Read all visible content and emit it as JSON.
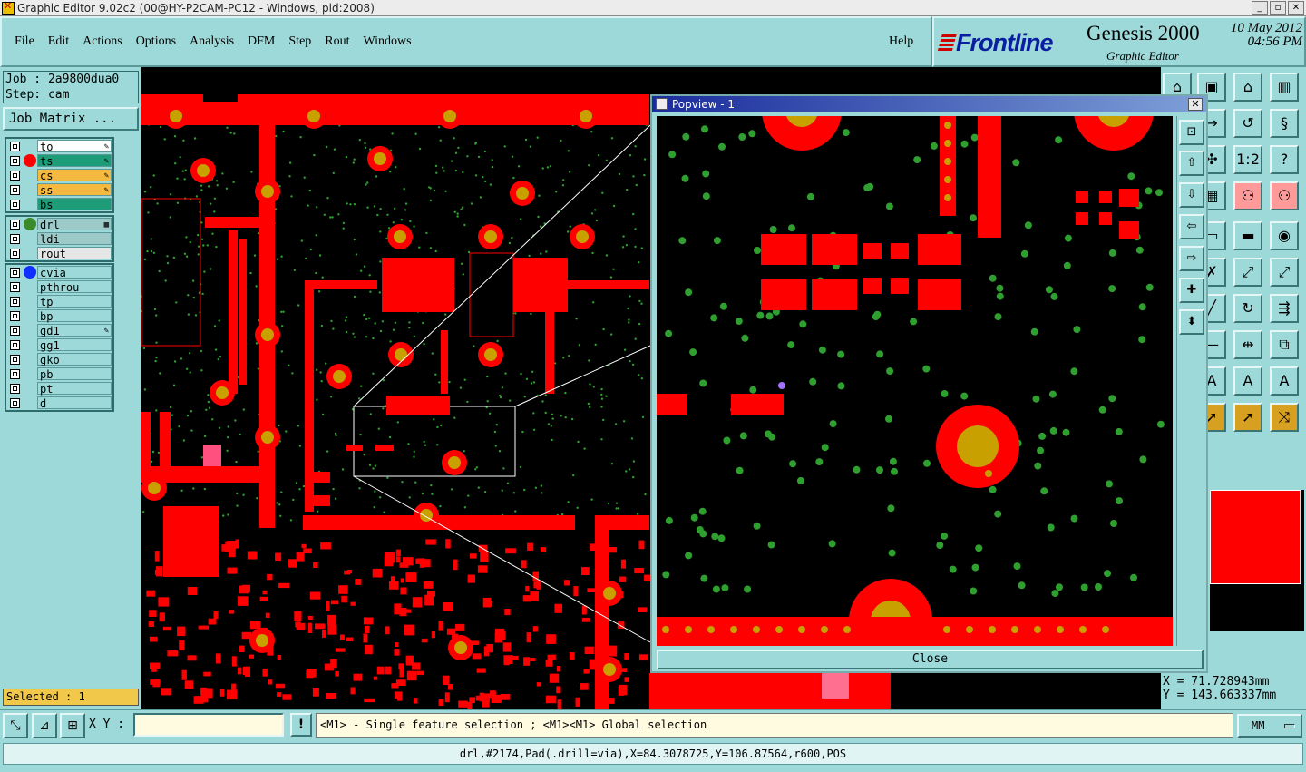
{
  "window": {
    "title": "Graphic Editor 9.02c2 (00@HY-P2CAM-PC12 - Windows, pid:2008)",
    "buttons": [
      "_",
      "▫",
      "✕"
    ]
  },
  "menu": {
    "items": [
      "File",
      "Edit",
      "Actions",
      "Options",
      "Analysis",
      "DFM",
      "Step",
      "Rout",
      "Windows"
    ],
    "help": "Help"
  },
  "brand": {
    "logo": "Frontline",
    "product": "Genesis 2000",
    "subtitle": "Graphic Editor",
    "date": "10 May 2012",
    "time": "04:56 PM"
  },
  "job": {
    "job_line": "Job : 2a9800dua0",
    "step_line": "Step: cam",
    "matrix_button": "Job Matrix ..."
  },
  "layer_groups": [
    {
      "layers": [
        {
          "name": "to",
          "bg": "#ffffff",
          "dot": "",
          "mark": "✎"
        },
        {
          "name": "ts",
          "bg": "#1e9c78",
          "dot": "#ff0000",
          "mark": "✎"
        },
        {
          "name": "cs",
          "bg": "#f5b93f",
          "dot": "",
          "mark": "✎"
        },
        {
          "name": "ss",
          "bg": "#f5b93f",
          "dot": "",
          "mark": "✎"
        },
        {
          "name": "bs",
          "bg": "#1e9c78",
          "dot": "",
          "mark": ""
        }
      ]
    },
    {
      "layers": [
        {
          "name": "drl",
          "bg": "#9ec9c9",
          "dot": "#3b8a2a",
          "mark": "▦"
        },
        {
          "name": "ldi",
          "bg": "#9ec9c9",
          "dot": "",
          "mark": ""
        },
        {
          "name": "rout",
          "bg": "#e6e6e6",
          "dot": "",
          "mark": ""
        }
      ]
    },
    {
      "layers": [
        {
          "name": "cvia",
          "bg": "#9ed9d9",
          "dot": "#1030ff",
          "mark": ""
        },
        {
          "name": "pthrou",
          "bg": "#9ed9d9",
          "dot": "",
          "mark": ""
        },
        {
          "name": "tp",
          "bg": "#9ed9d9",
          "dot": "",
          "mark": ""
        },
        {
          "name": "bp",
          "bg": "#9ed9d9",
          "dot": "",
          "mark": ""
        },
        {
          "name": "gd1",
          "bg": "#9ed9d9",
          "dot": "",
          "mark": "✎"
        },
        {
          "name": "gg1",
          "bg": "#9ed9d9",
          "dot": "",
          "mark": ""
        },
        {
          "name": "gko",
          "bg": "#9ed9d9",
          "dot": "",
          "mark": ""
        },
        {
          "name": "pb",
          "bg": "#9ed9d9",
          "dot": "",
          "mark": ""
        },
        {
          "name": "pt",
          "bg": "#9ed9d9",
          "dot": "",
          "mark": ""
        },
        {
          "name": "d",
          "bg": "#9ed9d9",
          "dot": "",
          "mark": ""
        }
      ]
    }
  ],
  "selected": "Selected : 1",
  "popview": {
    "title": "Popview - 1",
    "close": "Close"
  },
  "coords": {
    "x": "X  =  71.728943mm",
    "y": "Y  = 143.663337mm"
  },
  "cmd": {
    "xy_label": "X Y :",
    "xy_value": "",
    "excl": "!",
    "hint": "<M1> - Single feature selection ; <M1><M1> Global selection",
    "unit": "MM"
  },
  "status": "drl,#2174,Pad(.drill=via),X=84.3078725,Y=106.87564,r600,POS",
  "colors": {
    "copper": "#ff0000",
    "drill": "#c8a000",
    "via": "#2f9f2f",
    "background": "#000000",
    "panel": "#9ed9d9"
  }
}
